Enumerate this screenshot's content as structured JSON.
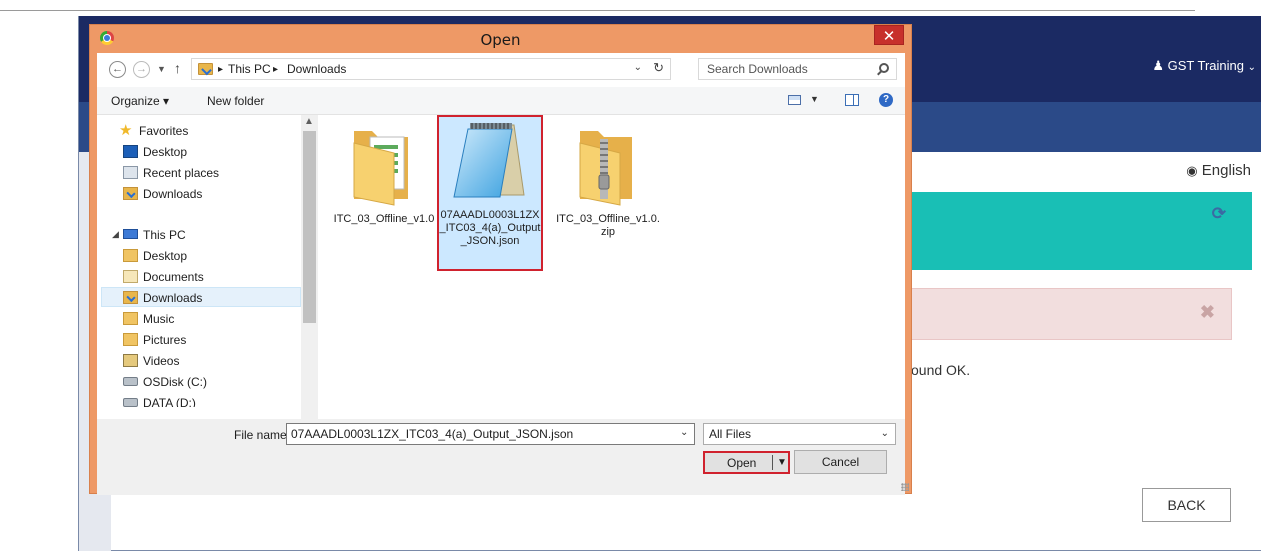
{
  "background_page": {
    "user_menu": "GST Training",
    "language": "English",
    "status_text": "ound OK.",
    "back_button": "BACK",
    "colors": {
      "header": "#1b2a63",
      "nav": "#2b4a88",
      "teal": "#19bfb5",
      "alert": "#f2dede"
    }
  },
  "dialog": {
    "title": "Open",
    "close_glyph": "✕",
    "address": {
      "segments": [
        "This PC",
        "Downloads"
      ],
      "separator": "▸"
    },
    "search": {
      "placeholder": "Search Downloads"
    },
    "toolbar": {
      "organize": "Organize ▾",
      "new_folder": "New folder"
    },
    "nav": {
      "favorites": "Favorites",
      "desktop": "Desktop",
      "recent_places": "Recent places",
      "downloads": "Downloads",
      "this_pc": "This PC",
      "pc_desktop": "Desktop",
      "documents": "Documents",
      "pc_downloads": "Downloads",
      "music": "Music",
      "pictures": "Pictures",
      "videos": "Videos",
      "osdisk": "OSDisk (C:)",
      "data": "DATA (D:)"
    },
    "files": [
      {
        "name": "ITC_03_Offline_v1.0",
        "icon": "folder-icon"
      },
      {
        "name": "07AAADL0003L1ZX_ITC03_4(a)_Output_JSON.json",
        "icon": "notepad-file-icon",
        "selected": true
      },
      {
        "name": "ITC_03_Offline_v1.0.zip",
        "icon": "zip-folder-icon"
      }
    ],
    "file_name_label": "File name:",
    "file_name_value": "07AAADL0003L1ZX_ITC03_4(a)_Output_JSON.json",
    "file_type": "All Files",
    "open_button": "Open",
    "cancel_button": "Cancel"
  }
}
